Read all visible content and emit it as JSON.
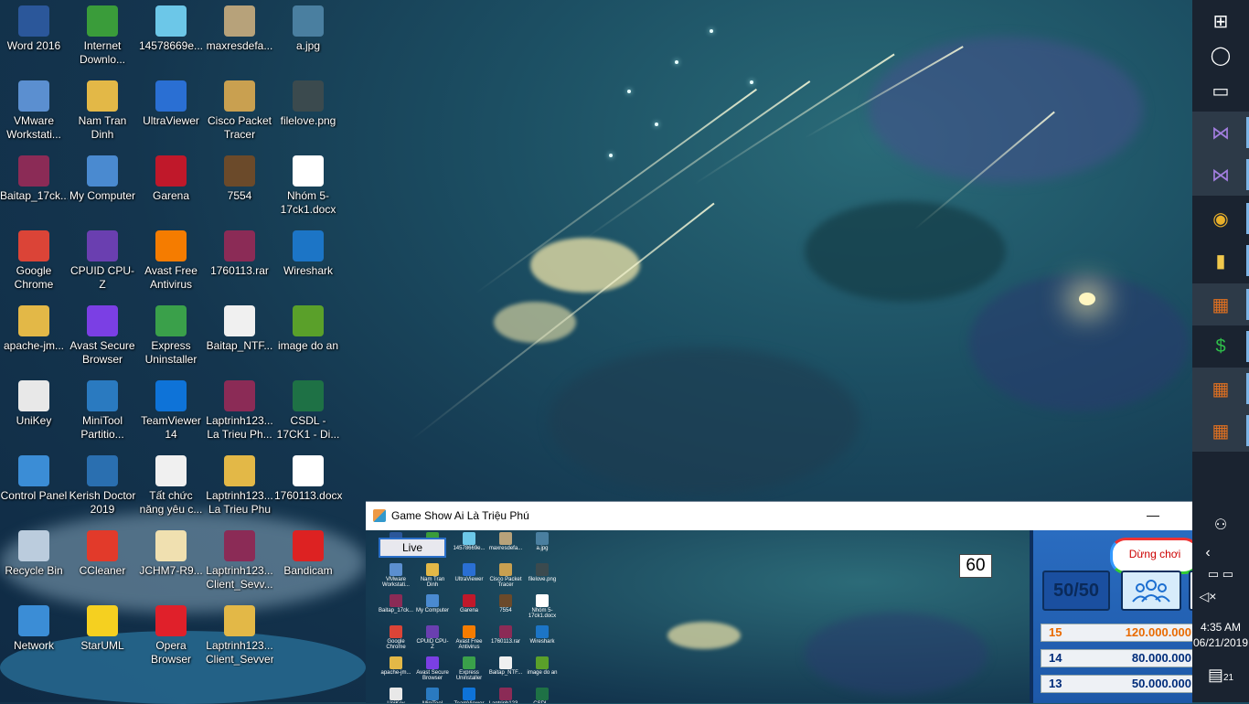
{
  "desktop": {
    "icons": [
      {
        "label": "Word 2016",
        "icon": "word-icon",
        "color": "#2b579a"
      },
      {
        "label": "Internet Downlo...",
        "icon": "download-globe-icon",
        "color": "#3a9c3a"
      },
      {
        "label": "14578669e...",
        "icon": "image-file-icon",
        "color": "#6cc7e8"
      },
      {
        "label": "maxresdefa...",
        "icon": "image-file-icon",
        "color": "#b7a27a"
      },
      {
        "label": "a.jpg",
        "icon": "image-file-icon",
        "color": "#4a7fa0"
      },
      {
        "label": "VMware Workstati...",
        "icon": "vmware-icon",
        "color": "#5b8fd0"
      },
      {
        "label": "Nam Tran Dinh",
        "icon": "user-folder-icon",
        "color": "#e3b847"
      },
      {
        "label": "UltraViewer",
        "icon": "ultraviewer-icon",
        "color": "#2a6fd3"
      },
      {
        "label": "Cisco Packet Tracer",
        "icon": "cisco-icon",
        "color": "#c9a050"
      },
      {
        "label": "filelove.png",
        "icon": "image-file-icon",
        "color": "#3b4a4e"
      },
      {
        "label": "Baitap_17ck...",
        "icon": "winrar-icon",
        "color": "#8b2b56"
      },
      {
        "label": "My Computer",
        "icon": "computer-icon",
        "color": "#4a8ad0"
      },
      {
        "label": "Garena",
        "icon": "garena-icon",
        "color": "#c0182a"
      },
      {
        "label": "7554",
        "icon": "game-icon",
        "color": "#6b4a2a"
      },
      {
        "label": "Nhóm 5-17ck1.docx",
        "icon": "docx-icon",
        "color": "#ffffff"
      },
      {
        "label": "Google Chrome",
        "icon": "chrome-icon",
        "color": "#db4437"
      },
      {
        "label": "CPUID CPU-Z",
        "icon": "cpuz-icon",
        "color": "#6a3fb0"
      },
      {
        "label": "Avast Free Antivirus",
        "icon": "avast-icon",
        "color": "#f57c00"
      },
      {
        "label": "1760113.rar",
        "icon": "winrar-icon",
        "color": "#8b2b56"
      },
      {
        "label": "Wireshark",
        "icon": "wireshark-icon",
        "color": "#1c75c6"
      },
      {
        "label": "apache-jm...",
        "icon": "folder-icon",
        "color": "#e3b847"
      },
      {
        "label": "Avast Secure Browser",
        "icon": "avast-browser-icon",
        "color": "#7b3fe4"
      },
      {
        "label": "Express Uninstaller",
        "icon": "uninstaller-icon",
        "color": "#3aa04a"
      },
      {
        "label": "Baitap_NTF...",
        "icon": "document-icon",
        "color": "#f0f0f0"
      },
      {
        "label": "image do an",
        "icon": "file-icon",
        "color": "#5aa02a"
      },
      {
        "label": "UniKey",
        "icon": "unikey-icon",
        "color": "#e8e8e8"
      },
      {
        "label": "MiniTool Partitio...",
        "icon": "minitool-icon",
        "color": "#2a7ac0"
      },
      {
        "label": "TeamViewer 14",
        "icon": "teamviewer-icon",
        "color": "#0e73d8"
      },
      {
        "label": "Laptrinh123... La Trieu Ph...",
        "icon": "winrar-icon",
        "color": "#8b2b56"
      },
      {
        "label": "CSDL - 17CK1 - Di...",
        "icon": "excel-icon",
        "color": "#1e7145"
      },
      {
        "label": "Control Panel",
        "icon": "control-panel-icon",
        "color": "#3b8dd6"
      },
      {
        "label": "Kerish Doctor 2019",
        "icon": "kerish-icon",
        "color": "#2a6fb0"
      },
      {
        "label": "Tất chức năng yêu c...",
        "icon": "document-icon",
        "color": "#f0f0f0"
      },
      {
        "label": "Laptrinh123... La Trieu Phu",
        "icon": "zip-folder-icon",
        "color": "#e3b847"
      },
      {
        "label": "1760113.docx",
        "icon": "docx-icon",
        "color": "#ffffff"
      },
      {
        "label": "Recycle Bin",
        "icon": "recycle-bin-icon",
        "color": "#bcd"
      },
      {
        "label": "CCleaner",
        "icon": "ccleaner-icon",
        "color": "#e23a2a"
      },
      {
        "label": "JCHM7-R9...",
        "icon": "file-icon",
        "color": "#f0e0b0"
      },
      {
        "label": "Laptrinh123... Client_Sevv...",
        "icon": "winrar-icon",
        "color": "#8b2b56"
      },
      {
        "label": "Bandicam",
        "icon": "bandicam-icon",
        "color": "#d22"
      },
      {
        "label": "Network",
        "icon": "network-icon",
        "color": "#3b8dd6"
      },
      {
        "label": "StarUML",
        "icon": "staruml-icon",
        "color": "#f5d020"
      },
      {
        "label": "Opera Browser",
        "icon": "opera-icon",
        "color": "#e0202a"
      },
      {
        "label": "Laptrinh123... Client_Sevver",
        "icon": "folder-icon",
        "color": "#e3b847"
      }
    ]
  },
  "taskbar": {
    "items": [
      {
        "icon": "windows-start-icon",
        "glyph": "⊞"
      },
      {
        "icon": "cortana-circle-icon",
        "glyph": "◯"
      },
      {
        "icon": "task-view-icon",
        "glyph": "▭"
      },
      {
        "icon": "visual-studio-icon",
        "glyph": "⋈",
        "color": "#a37ee0"
      },
      {
        "icon": "visual-studio-icon",
        "glyph": "⋈",
        "color": "#a37ee0"
      },
      {
        "icon": "chrome-icon",
        "glyph": "◉",
        "color": "#e9b02a"
      },
      {
        "icon": "file-explorer-icon",
        "glyph": "▮",
        "color": "#f2c94c"
      },
      {
        "icon": "winforms-app-icon",
        "glyph": "▦",
        "color": "#e07020"
      },
      {
        "icon": "dollar-app-icon",
        "glyph": "$",
        "color": "#2fbf4a"
      },
      {
        "icon": "winforms-app-icon",
        "glyph": "▦",
        "color": "#e07020"
      },
      {
        "icon": "winforms-app-icon",
        "glyph": "▦",
        "color": "#e07020"
      }
    ],
    "tray": {
      "people_icon": "people-icon",
      "chevron_icon": "chevron-left-icon",
      "network_icon": "network-tray-icon",
      "volume_icon": "volume-mute-icon",
      "time": "4:35 AM",
      "date": "06/21/2019",
      "notifications_count": "21"
    }
  },
  "game_window": {
    "title": "Game Show Ai Là Triệu Phú",
    "minimize_glyph": "—",
    "live_label": "Live",
    "timer": "60",
    "stop_label": "Dừng chơi",
    "fifty_label": "50/50",
    "prizes": [
      {
        "level": "15",
        "amount": "120.000.000",
        "highlight": true
      },
      {
        "level": "14",
        "amount": "80.000.000",
        "highlight": false
      },
      {
        "level": "13",
        "amount": "50.000.000",
        "highlight": false
      }
    ]
  }
}
